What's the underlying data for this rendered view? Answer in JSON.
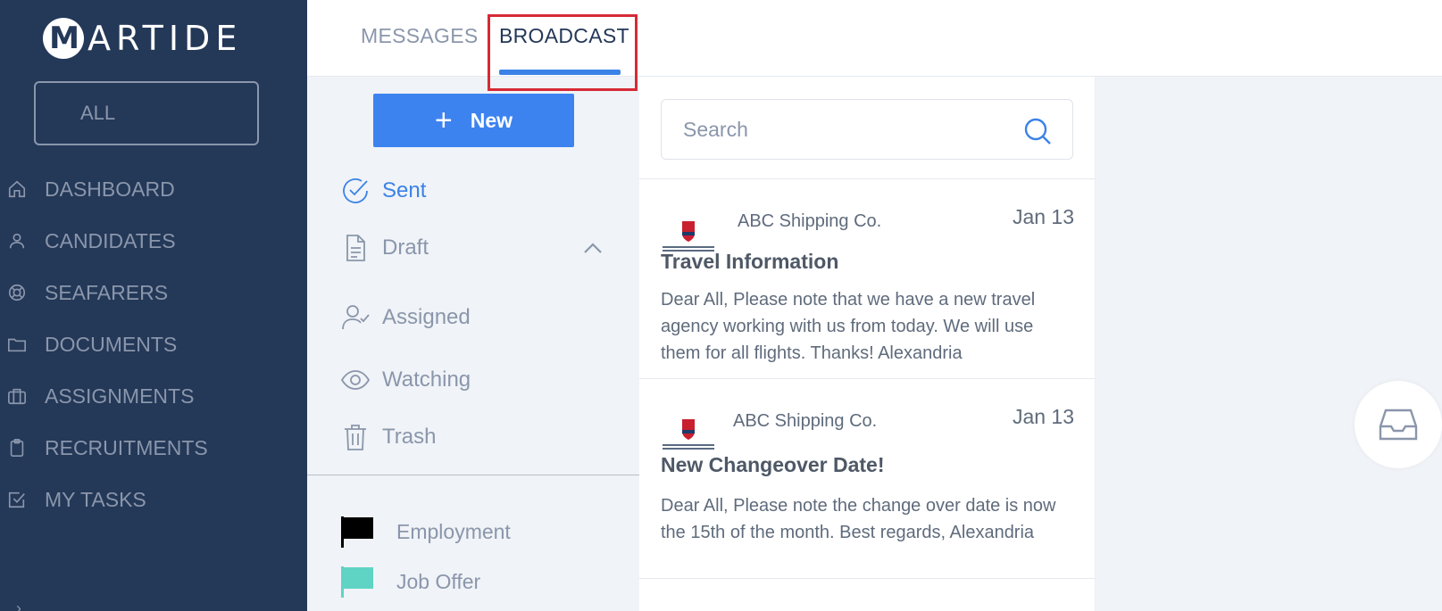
{
  "app": {
    "brand_initial": "M",
    "brand_rest": "ARTIDE"
  },
  "sidebar": {
    "filter_label": "ALL",
    "items": [
      {
        "label": "DASHBOARD",
        "icon": "home-icon"
      },
      {
        "label": "CANDIDATES",
        "icon": "user-icon"
      },
      {
        "label": "SEAFARERS",
        "icon": "lifebuoy-icon"
      },
      {
        "label": "DOCUMENTS",
        "icon": "folder-icon"
      },
      {
        "label": "ASSIGNMENTS",
        "icon": "briefcase-icon"
      },
      {
        "label": "RECRUITMENTS",
        "icon": "clipboard-icon"
      },
      {
        "label": "MY TASKS",
        "icon": "checkbox-icon"
      }
    ]
  },
  "tabs": [
    {
      "label": "MESSAGES",
      "active": false
    },
    {
      "label": "BROADCAST",
      "active": true
    }
  ],
  "folders": {
    "new_label": "New",
    "items": [
      {
        "label": "Sent",
        "icon": "check-circle-icon",
        "active": true
      },
      {
        "label": "Draft",
        "icon": "document-icon",
        "active": false
      },
      {
        "label": "Assigned",
        "icon": "user-check-icon",
        "active": false
      },
      {
        "label": "Watching",
        "icon": "eye-icon",
        "active": false
      },
      {
        "label": "Trash",
        "icon": "trash-icon",
        "active": false
      }
    ],
    "labels": [
      {
        "label": "Employment",
        "color": "#000000"
      },
      {
        "label": "Job Offer",
        "color": "#5fd4c4"
      }
    ]
  },
  "search": {
    "placeholder": "Search"
  },
  "messages": [
    {
      "sender": "ABC Shipping Co.",
      "date": "Jan 13",
      "subject": "Travel Information",
      "body": "Dear All, Please note that we have a new travel agency working with us from today. We will use them for all flights. Thanks! Alexandria"
    },
    {
      "sender": "ABC Shipping Co.",
      "date": "Jan 13",
      "subject": "New Changeover Date!",
      "body": "Dear All, Please note the change over date is now the 15th of the month. Best regards, Alexandria"
    }
  ],
  "colors": {
    "sidebar": "#243858",
    "accent": "#3b82e8",
    "highlight": "#d62a36"
  }
}
